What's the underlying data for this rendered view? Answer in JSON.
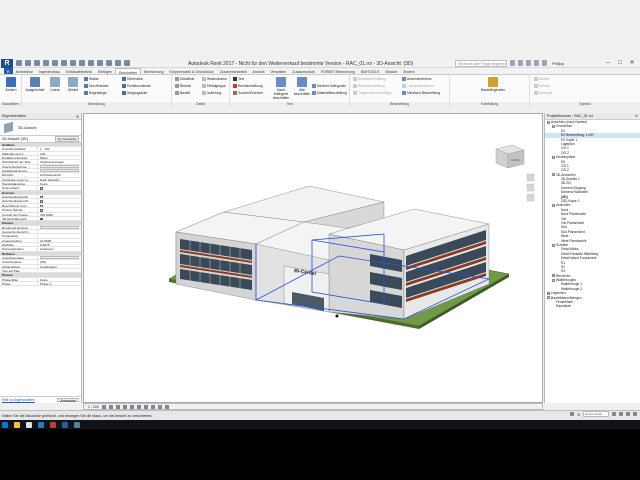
{
  "app": {
    "logo": "R",
    "window_title": "Autodesk Revit 2017 - Nicht für den Weiterverkauf bestimmte Version -  RAC_01.rvt - 3D-Ansicht: {3D}",
    "search_placeholder": "Stichwort oder Frage eingeben",
    "user": "Philipp"
  },
  "tabs": [
    {
      "label": "R",
      "type": "file"
    },
    {
      "label": "Architektur"
    },
    {
      "label": "Ingenieurbau"
    },
    {
      "label": "Gebäudetechnik"
    },
    {
      "label": "Einfügen"
    },
    {
      "label": "Beschriften",
      "active": true
    },
    {
      "label": "Berechnung"
    },
    {
      "label": "Körpermodell & Grundstück"
    },
    {
      "label": "Zusammenarbeit"
    },
    {
      "label": "Ansicht"
    },
    {
      "label": "Verwalten"
    },
    {
      "label": "Zusatzmodule"
    },
    {
      "label": "FORMIT Berechnung"
    },
    {
      "label": "BIMTOOLS"
    },
    {
      "label": "Module"
    },
    {
      "label": "Ändern"
    }
  ],
  "ribbon": {
    "groups": [
      {
        "label": "Auswählen",
        "button": "Ändern"
      },
      {
        "label": "Bemaßung",
        "buttons": [
          "Ausgerichtet",
          "Linear",
          "Winkel"
        ],
        "small": [
          "Radial",
          "Durchmesser",
          "Bogenlänge"
        ],
        "small2": [
          "Höhenkote",
          "Punktkoordinate",
          "Neigungskote"
        ]
      },
      {
        "label": "Detail",
        "small": [
          "Detaillinie",
          "Bereich",
          "Bauteil"
        ],
        "small2": [
          "Wolkenkontur",
          "Detailgruppe",
          "Isolierung"
        ]
      },
      {
        "label": "Text",
        "small": [
          "Text",
          "Rechtschreibung",
          "Suchen/Ersetzen"
        ],
        "buttons": [
          "Nach Kategorie beschriften",
          "Alle beschriften"
        ],
        "small2": [
          "Mehrere Kategorien",
          "Materialbeschriftung"
        ]
      },
      {
        "label": "Beschriftung",
        "small": [
          "Bauteilbeschriftung",
          "Raumbeschriftung",
          "Tragwerksbeschriftung"
        ],
        "small2": [
          "Ansichtsreferenz",
          "Lesbarkeitsbeschr.",
          "Mehrfach-Beschriftung"
        ]
      },
      {
        "label": "Farbfüllung",
        "buttons": [
          "Bauteillegenden"
        ]
      },
      {
        "label": "Symbol",
        "small": [
          "Bauteil",
          "Bereich",
          "Nordpfeil"
        ]
      }
    ]
  },
  "properties": {
    "title": "Eigenschaften",
    "type_name": "3D-Ansicht",
    "selector": "3D-Ansicht: {3D}",
    "edit_type": "Typ bearbeiten",
    "rows": [
      {
        "section": "Grafiken"
      },
      {
        "k": "Ansichtsmaßstab",
        "v": "1 : 100"
      },
      {
        "k": "Maßstab wert 1:",
        "v": "100"
      },
      {
        "k": "Detaillierungsgrad",
        "v": "Mittel"
      },
      {
        "k": "Sichtbarkeit der Teile",
        "v": "Original anzeigen"
      },
      {
        "k": "Überschreibungen ...",
        "v": "Bearbeiten...",
        "btn": true
      },
      {
        "k": "Grafikdarstellungs...",
        "v": "Bearbeiten...",
        "btn": true
      },
      {
        "k": "Disziplin",
        "v": "Architektonisch"
      },
      {
        "k": "Verdeckte Linien a...",
        "v": "Nach Disziplin"
      },
      {
        "k": "Standardanalyse...",
        "v": "Keine"
      },
      {
        "k": "Sonnenbahn",
        "chk": false
      },
      {
        "section": "Grenzen"
      },
      {
        "k": "Zuschneidebereich",
        "chk": false
      },
      {
        "k": "Zuschneidebereich...",
        "chk": false
      },
      {
        "k": "Beschriftung zusc...",
        "chk": false
      },
      {
        "k": "Hintere Schnitt...",
        "chk": false
      },
      {
        "k": "Versatz der hintere...",
        "v": "304,8000"
      },
      {
        "k": "3D-Schnittbereich",
        "chk": true
      },
      {
        "section": "Kamera"
      },
      {
        "k": "Rendering-Einstell...",
        "v": "Bearbeiten...",
        "btn": true
      },
      {
        "k": "Gesperrte Ausricht...",
        "v": ""
      },
      {
        "k": "Perspektive",
        "v": ""
      },
      {
        "k": "Augenposition",
        "v": "21,0996"
      },
      {
        "k": "Zielhöhe",
        "v": "6,8275"
      },
      {
        "k": "Kameraposition",
        "v": "Anpassen"
      },
      {
        "section": "ID-Daten"
      },
      {
        "k": "Ansichtsvorlage",
        "v": "<Keine Auswahl>",
        "btn": true
      },
      {
        "k": "Ansichtsname",
        "v": "{3D}"
      },
      {
        "k": "Abhängigkeit",
        "v": "Unabhängig"
      },
      {
        "k": "Titel auf Plan",
        "v": ""
      },
      {
        "section": "Phasen"
      },
      {
        "k": "Phasenfilter",
        "v": "Keine"
      },
      {
        "k": "Phase",
        "v": "Phase 1"
      }
    ],
    "help_link": "Hilfe zu Eigenschaften",
    "apply": "Anwenden"
  },
  "canvas": {
    "building_sign": "Bi-Center",
    "viewcube": "LINKS"
  },
  "browser": {
    "title": "Projektbrowser - RAC_01.rvt",
    "items": [
      {
        "t": "Ansichten (nach Namen)",
        "lvl": 0,
        "tw": "-"
      },
      {
        "t": "Grundrisse",
        "lvl": 1,
        "tw": "-"
      },
      {
        "t": "E0",
        "lvl": 2
      },
      {
        "t": "E0 Beschriftung 1:100",
        "lvl": 2,
        "sel": true
      },
      {
        "t": "E0 Kopie 1",
        "lvl": 2
      },
      {
        "t": "Lageplan",
        "lvl": 2
      },
      {
        "t": "OG 1",
        "lvl": 2
      },
      {
        "t": "OG 2",
        "lvl": 2
      },
      {
        "t": "Deckenpläne",
        "lvl": 1,
        "tw": "-"
      },
      {
        "t": "E0",
        "lvl": 2
      },
      {
        "t": "OG 1",
        "lvl": 2
      },
      {
        "t": "OG 2",
        "lvl": 2
      },
      {
        "t": "3D-Ansichten",
        "lvl": 1,
        "tw": "-"
      },
      {
        "t": "3D-Ansicht 1",
        "lvl": 2
      },
      {
        "t": "3D-SO",
        "lvl": 2
      },
      {
        "t": "Kamera Eingang",
        "lvl": 2
      },
      {
        "t": "Kamera Rückseite",
        "lvl": 2
      },
      {
        "t": "{3D}",
        "lvl": 2,
        "bold": true
      },
      {
        "t": "{3D} Kopie 1",
        "lvl": 2
      },
      {
        "t": "Ansichten",
        "lvl": 1,
        "tw": "-"
      },
      {
        "t": "Nord",
        "lvl": 2
      },
      {
        "t": "Nord Planansicht",
        "lvl": 2
      },
      {
        "t": "Ost",
        "lvl": 2
      },
      {
        "t": "Ost Planansicht",
        "lvl": 2
      },
      {
        "t": "Süd",
        "lvl": 2
      },
      {
        "t": "Süd Planansicht",
        "lvl": 2
      },
      {
        "t": "West",
        "lvl": 2
      },
      {
        "t": "West Planansicht",
        "lvl": 2
      },
      {
        "t": "Schnitte",
        "lvl": 1,
        "tw": "-"
      },
      {
        "t": "Detail Attika",
        "lvl": 2
      },
      {
        "t": "Detail Fassade Mittelberg",
        "lvl": 2
      },
      {
        "t": "Detail Wand Fundament",
        "lvl": 2
      },
      {
        "t": "S1",
        "lvl": 2
      },
      {
        "t": "S2",
        "lvl": 2
      },
      {
        "t": "S3",
        "lvl": 2
      },
      {
        "t": "Renderen",
        "lvl": 1,
        "tw": "+"
      },
      {
        "t": "Walkthroughs",
        "lvl": 1,
        "tw": "-"
      },
      {
        "t": "Walkthrough 1",
        "lvl": 2
      },
      {
        "t": "Walkthrough 2",
        "lvl": 2
      },
      {
        "t": "Legenden",
        "lvl": 0,
        "tw": "+"
      },
      {
        "t": "Bauteillisten/Mengen",
        "lvl": 0,
        "tw": "-"
      },
      {
        "t": "Fensterliste",
        "lvl": 1
      },
      {
        "t": "Raumliste",
        "lvl": 1
      }
    ]
  },
  "viewbar": {
    "scale": "1 : 100"
  },
  "status": {
    "text": "Halten Sie die Mausrolle gedrückt, und bewegen Sie die Maus, um die Ansicht zu verschieben.",
    "dropdown": "Hauptmodell",
    "zero": ":0"
  },
  "colors": {
    "selection_blue": "#2b4fd6",
    "ground": "#5c8a3a",
    "glass": "#3a4a58"
  }
}
